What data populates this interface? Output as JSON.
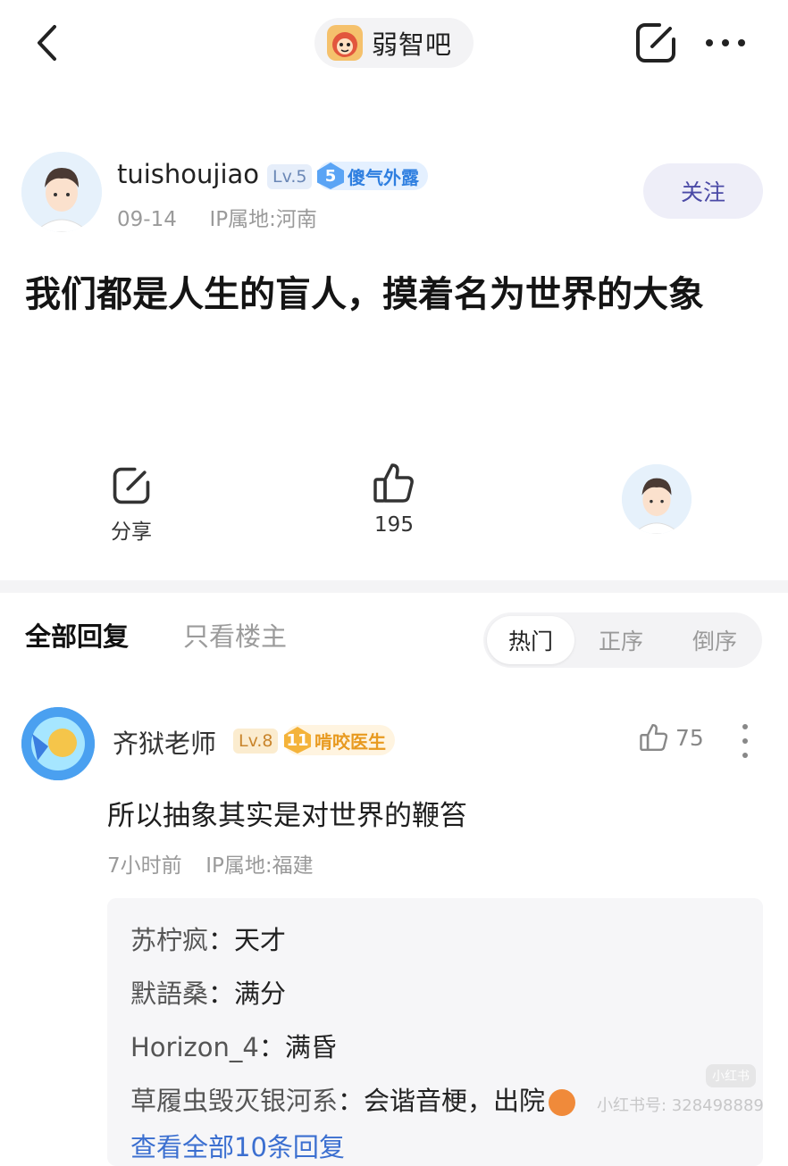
{
  "top_bar": {
    "forum_name": "弱智吧",
    "back_icon": "chevron-left-icon",
    "edit_icon": "edit-icon",
    "more_icon": "more-horizontal-icon"
  },
  "post": {
    "author": {
      "name": "tuishoujiao",
      "level": "Lv.5",
      "title_level": "5",
      "title": "傻气外露"
    },
    "date": "09-14",
    "ip_location": "IP属地:河南",
    "follow_label": "关注",
    "content": "我们都是人生的盲人，摸着名为世界的大象",
    "actions": {
      "share_label": "分享",
      "like_count": "195"
    }
  },
  "replies_header": {
    "tab_all": "全部回复",
    "tab_owner_only": "只看楼主",
    "sort_options": [
      "热门",
      "正序",
      "倒序"
    ],
    "sort_selected": "热门"
  },
  "reply": {
    "author": "齐狱老师",
    "level": "Lv.8",
    "title_level": "11",
    "title": "啃咬医生",
    "like_count": "75",
    "text": "所以抽象其实是对世界的鞭笞",
    "time": "7小时前",
    "ip_location": "IP属地:福建",
    "sub_replies": [
      {
        "author": "苏柠疯",
        "text": "天才"
      },
      {
        "author": "默語桑",
        "text": "满分"
      },
      {
        "author": "Horizon_4",
        "text": "满昏"
      },
      {
        "author": "草履虫毁灭银河系",
        "text": "会谐音梗，出院"
      }
    ],
    "view_all": "查看全部10条回复"
  },
  "watermark": {
    "brand": "小红书",
    "id_text": "小红书号: 328498889"
  },
  "colors": {
    "follow_text": "#4b4aa6",
    "link_blue": "#3b6fd0",
    "badge_blue": "#5aa4f5",
    "badge_orange": "#f4b33a"
  }
}
